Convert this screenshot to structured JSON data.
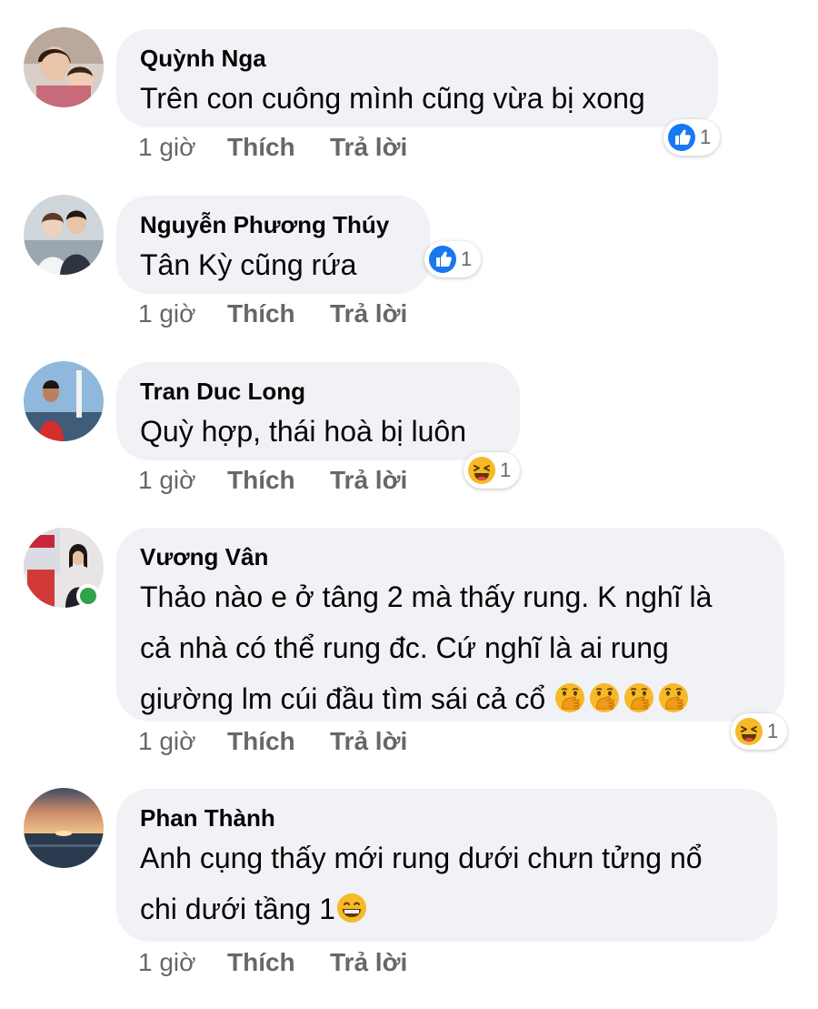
{
  "colors": {
    "bubble": "#f0f2f5",
    "meta_text": "#65676b",
    "like_blue": "#1877f2",
    "online": "#31a24c",
    "haha_yellow": "#f7b928"
  },
  "icons": {
    "like": "thumbs-up-icon",
    "haha": "laughing-face-icon",
    "hand_over_mouth": "face-with-hand-over-mouth-icon",
    "grin": "grinning-face-icon"
  },
  "comments": [
    {
      "author": "Quỳnh Nga",
      "lines": [
        "Trên con cuông mình cũng vừa bị xong"
      ],
      "time": "1 giờ",
      "like_label": "Thích",
      "reply_label": "Trả lời",
      "reaction": {
        "type": "like",
        "count": "1"
      }
    },
    {
      "author": "Nguyễn Phương Thúy",
      "lines": [
        "Tân Kỳ cũng rứa"
      ],
      "time": "1 giờ",
      "like_label": "Thích",
      "reply_label": "Trả lời",
      "reaction": {
        "type": "like",
        "count": "1"
      }
    },
    {
      "author": "Tran Duc Long",
      "lines": [
        "Quỳ hợp, thái hoà bị luôn"
      ],
      "time": "1 giờ",
      "like_label": "Thích",
      "reply_label": "Trả lời",
      "reaction": {
        "type": "haha",
        "count": "1"
      }
    },
    {
      "author": "Vương Vân",
      "online": true,
      "lines": [
        "Thảo nào e ở tâng 2 mà thấy rung. K nghĩ là",
        "cả nhà có thể rung đc. Cứ nghĩ là ai rung",
        "giường lm cúi đầu tìm sái cả cổ"
      ],
      "trailing_emoji": [
        "face-with-hand-over-mouth-icon",
        "face-with-hand-over-mouth-icon",
        "face-with-hand-over-mouth-icon",
        "face-with-hand-over-mouth-icon"
      ],
      "time": "1 giờ",
      "like_label": "Thích",
      "reply_label": "Trả lời",
      "reaction": {
        "type": "haha",
        "count": "1"
      }
    },
    {
      "author": "Phan Thành",
      "lines": [
        "Anh cụng thấy mới rung dưới chưn tửng nổ",
        "chi dưới tầng 1"
      ],
      "trailing_emoji": [
        "grinning-face-icon"
      ],
      "time": "1 giờ",
      "like_label": "Thích",
      "reply_label": "Trả lời"
    }
  ]
}
